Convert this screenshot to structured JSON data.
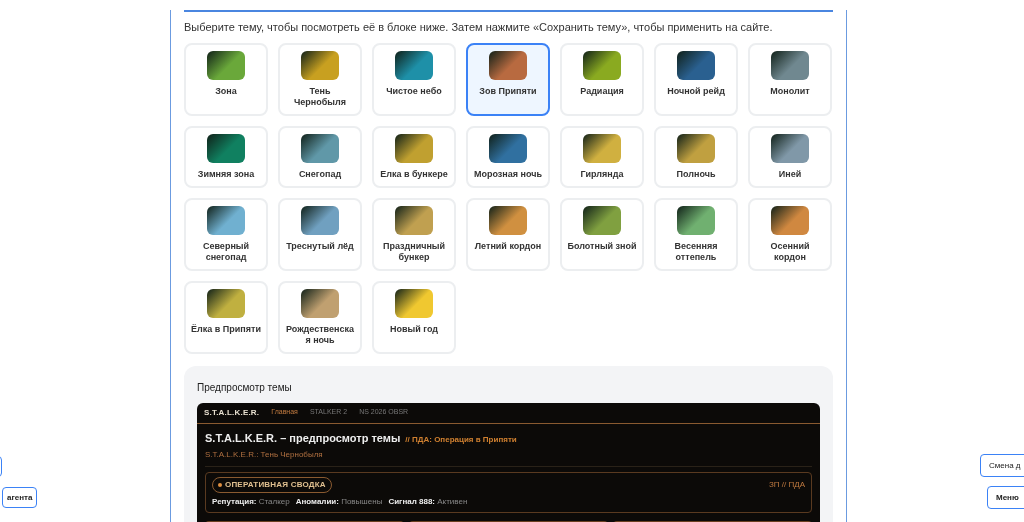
{
  "theme_section": {
    "description": "Выберите тему, чтобы посмотреть её в блоке ниже. Затем нажмите «Сохранить тему», чтобы применить на сайте.",
    "themes": [
      {
        "name": "Зона",
        "color": "#6aa83a",
        "selected": false
      },
      {
        "name": "Тень Чернобыля",
        "color": "#c8a020",
        "selected": false
      },
      {
        "name": "Чистое небо",
        "color": "#1e90a8",
        "selected": false
      },
      {
        "name": "Зов Припяти",
        "color": "#b86a40",
        "selected": true
      },
      {
        "name": "Радиация",
        "color": "#8aaa20",
        "selected": false
      },
      {
        "name": "Ночной рейд",
        "color": "#2a6090",
        "selected": false
      },
      {
        "name": "Монолит",
        "color": "#708890",
        "selected": false
      },
      {
        "name": "Зимняя зона",
        "color": "#108060",
        "selected": false
      },
      {
        "name": "Снегопад",
        "color": "#6098a8",
        "selected": false
      },
      {
        "name": "Елка в бункере",
        "color": "#c0a030",
        "selected": false
      },
      {
        "name": "Морозная ночь",
        "color": "#3070a0",
        "selected": false
      },
      {
        "name": "Гирлянда",
        "color": "#d0b040",
        "selected": false
      },
      {
        "name": "Полночь",
        "color": "#c0a040",
        "selected": false
      },
      {
        "name": "Иней",
        "color": "#8098a8",
        "selected": false
      },
      {
        "name": "Северный снегопад",
        "color": "#70b0d0",
        "selected": false
      },
      {
        "name": "Треснутый лёд",
        "color": "#70a0c0",
        "selected": false
      },
      {
        "name": "Праздничный бункер",
        "color": "#c0a050",
        "selected": false
      },
      {
        "name": "Летний кордон",
        "color": "#d09040",
        "selected": false
      },
      {
        "name": "Болотный зной",
        "color": "#80a040",
        "selected": false
      },
      {
        "name": "Весенняя оттепель",
        "color": "#70b070",
        "selected": false
      },
      {
        "name": "Осенний кордон",
        "color": "#d08840",
        "selected": false
      },
      {
        "name": "Ёлка в Припяти",
        "color": "#c0b040",
        "selected": false
      },
      {
        "name": "Рождественская ночь",
        "color": "#c0a070",
        "selected": false
      },
      {
        "name": "Новый год",
        "color": "#f0c830",
        "selected": false
      }
    ]
  },
  "preview": {
    "title": "Предпросмотр темы",
    "site": {
      "logo": "S.T.A.L.K.E.R.",
      "nav": [
        {
          "label": "Главная",
          "selected": true
        },
        {
          "label": "STALKER 2",
          "selected": false
        },
        {
          "label": "NS 2026 OBSR",
          "selected": false
        }
      ],
      "heading": "S.T.A.L.K.E.R. – предпросмотр темы",
      "heading_tag": "// ПДА: Операция в Припяти",
      "subtitle": "S.T.A.L.K.E.R.: Тень Чернобыля",
      "summary": {
        "badge": "ОПЕРАТИВНАЯ СВОДКА",
        "right": "ЗП // ПДА",
        "stats": [
          {
            "label": "Репутация:",
            "value": "Сталкер"
          },
          {
            "label": "Аномалии:",
            "value": "Повышены"
          },
          {
            "label": "Сигнал 888:",
            "value": "Активен"
          }
        ]
      }
    }
  },
  "side_buttons": {
    "left": [
      {
        "label": "агента"
      }
    ],
    "right": [
      {
        "label": "Смена д"
      },
      {
        "label": "Меню"
      }
    ]
  }
}
